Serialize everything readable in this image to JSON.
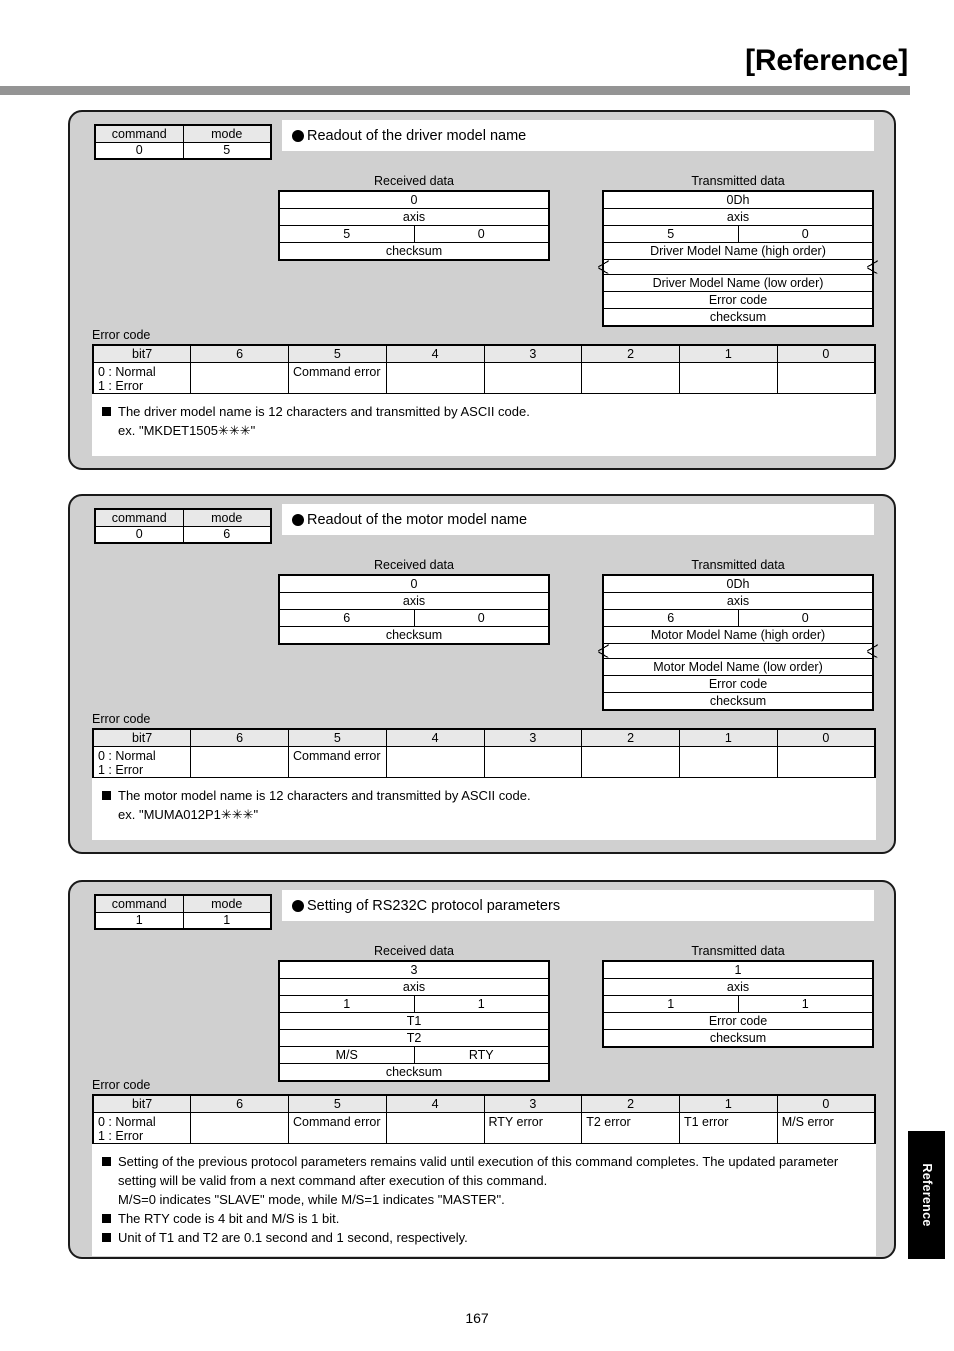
{
  "header": {
    "title": "[Reference]",
    "side_tab_label": "Reference",
    "page_number": "167"
  },
  "labels": {
    "command": "command",
    "mode": "mode",
    "received_data": "Received data",
    "transmitted_data": "Transmitted data",
    "error_code": "Error code",
    "bit7": "bit7",
    "bit6": "6",
    "bit5": "5",
    "bit4": "4",
    "bit3": "3",
    "bit2": "2",
    "bit1": "1",
    "bit0": "0",
    "normal_error": "0 : Normal\n1 : Error",
    "blank": ""
  },
  "panels": [
    {
      "title": "Readout of the driver model name",
      "command": "0",
      "mode": "5",
      "received": {
        "caption": "Received data",
        "rows": [
          {
            "type": "full",
            "text": "0"
          },
          {
            "type": "full",
            "text": "axis"
          },
          {
            "type": "split",
            "left": "5",
            "right": "0"
          },
          {
            "type": "full",
            "text": "checksum"
          }
        ]
      },
      "transmitted": {
        "caption": "Transmitted data",
        "rows": [
          {
            "type": "full",
            "text": "0Dh"
          },
          {
            "type": "full",
            "text": "axis"
          },
          {
            "type": "split",
            "left": "5",
            "right": "0"
          },
          {
            "type": "full",
            "text": "Driver Model Name (high order)"
          },
          {
            "type": "break",
            "text": ""
          },
          {
            "type": "full",
            "text": "Driver Model Name (low order)"
          },
          {
            "type": "full",
            "text": "Error code"
          },
          {
            "type": "full",
            "text": "checksum"
          }
        ]
      },
      "error_bits": [
        "0 : Normal\n1 : Error",
        "",
        "Command error",
        "",
        "",
        "",
        "",
        ""
      ],
      "notes": [
        {
          "bullet": true,
          "text": "The driver model name is 12 characters and transmitted by ASCII code."
        },
        {
          "bullet": false,
          "text": "ex.  \"MKDET1505✳✳✳\""
        }
      ]
    },
    {
      "title": "Readout of the motor model name",
      "command": "0",
      "mode": "6",
      "received": {
        "caption": "Received data",
        "rows": [
          {
            "type": "full",
            "text": "0"
          },
          {
            "type": "full",
            "text": "axis"
          },
          {
            "type": "split",
            "left": "6",
            "right": "0"
          },
          {
            "type": "full",
            "text": "checksum"
          }
        ]
      },
      "transmitted": {
        "caption": "Transmitted data",
        "rows": [
          {
            "type": "full",
            "text": "0Dh"
          },
          {
            "type": "full",
            "text": "axis"
          },
          {
            "type": "split",
            "left": "6",
            "right": "0"
          },
          {
            "type": "full",
            "text": "Motor Model Name (high order)"
          },
          {
            "type": "break",
            "text": ""
          },
          {
            "type": "full",
            "text": "Motor Model Name (low order)"
          },
          {
            "type": "full",
            "text": "Error code"
          },
          {
            "type": "full",
            "text": "checksum"
          }
        ]
      },
      "error_bits": [
        "0 : Normal\n1 : Error",
        "",
        "Command error",
        "",
        "",
        "",
        "",
        ""
      ],
      "notes": [
        {
          "bullet": true,
          "text": "The motor model name is 12 characters and transmitted by ASCII code."
        },
        {
          "bullet": false,
          "text": "ex.  \"MUMA012P1✳✳✳\""
        }
      ]
    },
    {
      "title": "Setting of RS232C protocol parameters",
      "command": "1",
      "mode": "1",
      "received": {
        "caption": "Received data",
        "rows": [
          {
            "type": "full",
            "text": "3"
          },
          {
            "type": "full",
            "text": "axis"
          },
          {
            "type": "split",
            "left": "1",
            "right": "1"
          },
          {
            "type": "full",
            "text": "T1"
          },
          {
            "type": "full",
            "text": "T2"
          },
          {
            "type": "split",
            "left": "M/S",
            "right": "RTY"
          },
          {
            "type": "full",
            "text": "checksum"
          }
        ]
      },
      "transmitted": {
        "caption": "Transmitted data",
        "rows": [
          {
            "type": "full",
            "text": "1"
          },
          {
            "type": "full",
            "text": "axis"
          },
          {
            "type": "split",
            "left": "1",
            "right": "1"
          },
          {
            "type": "full",
            "text": "Error code"
          },
          {
            "type": "full",
            "text": "checksum"
          }
        ]
      },
      "error_bits": [
        "0 : Normal\n1 : Error",
        "",
        "Command error",
        "",
        "RTY error",
        "T2 error",
        "T1 error",
        "M/S error"
      ],
      "notes": [
        {
          "bullet": true,
          "text": "Setting of the previous protocol parameters remains valid until execution of this command completes.  The updated parameter setting will be valid from a next command after execution of this command."
        },
        {
          "bullet": false,
          "text": "M/S=0 indicates \"SLAVE\" mode, while M/S=1 indicates \"MASTER\"."
        },
        {
          "bullet": true,
          "text": "The RTY code is 4 bit and M/S is 1 bit."
        },
        {
          "bullet": true,
          "text": "Unit of T1 and T2 are 0.1 second and 1 second, respectively."
        }
      ]
    }
  ]
}
